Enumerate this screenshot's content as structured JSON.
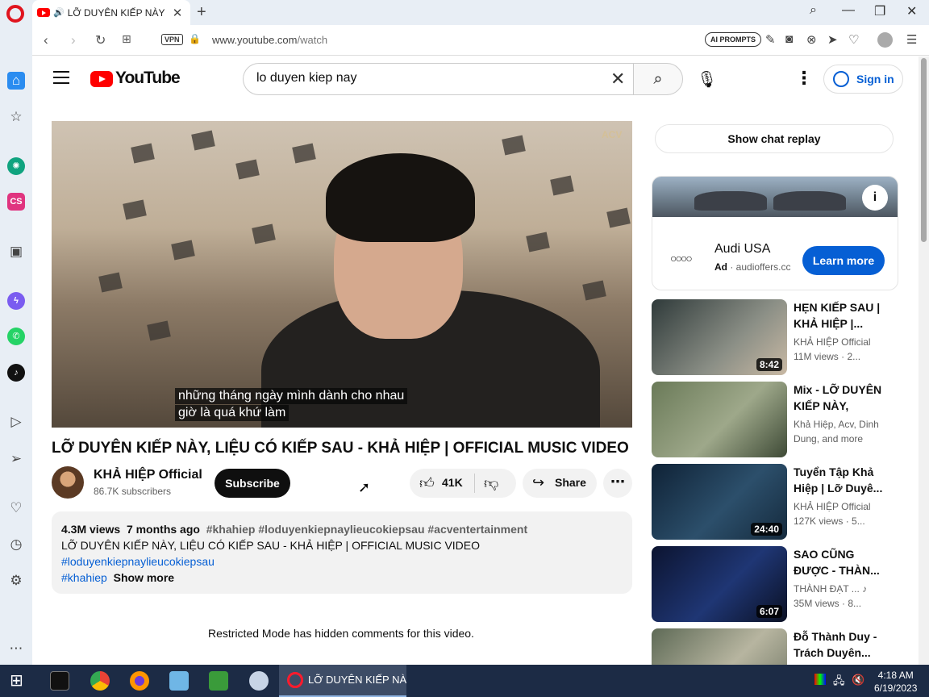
{
  "browser": {
    "tab_title": "LỠ DUYÊN KIẾP NÀY, LI",
    "url_host": "www.youtube.com",
    "url_path": "/watch",
    "vpn_label": "VPN",
    "ai_prompts_label": "AI PROMPTS",
    "new_tab_glyph": "+",
    "tab_close_glyph": "✕"
  },
  "youtube": {
    "logo_text": "YouTube",
    "search_value": "lo duyen kiep nay",
    "sign_in_label": "Sign in"
  },
  "video": {
    "subtitle_line1": "những tháng ngày mình dành cho nhau",
    "subtitle_line2": "giờ là quá khứ làm",
    "watermark": "ACV",
    "title": "LỠ DUYÊN KIẾP NÀY, LIỆU CÓ KIẾP SAU - KHẢ HIỆP | OFFICIAL MUSIC VIDEO",
    "channel_name": "KHẢ HIỆP Official",
    "subscribers": "86.7K subscribers",
    "subscribe_label": "Subscribe",
    "like_count": "41K",
    "share_label": "Share"
  },
  "description": {
    "views": "4.3M views",
    "age": "7 months ago",
    "tags": "#khahiep #loduyenkiepnaylieucokiepsau #acventertainment",
    "line1": "LỠ DUYÊN KIẾP NÀY, LIỆU CÓ KIẾP SAU - KHẢ HIỆP | OFFICIAL MUSIC VIDEO",
    "link1": "#loduyenkiepnaylieucokiepsau",
    "link2": "#khahiep",
    "show_more": "Show more"
  },
  "comments": {
    "restricted_note": "Restricted Mode has hidden comments for this video."
  },
  "sidebar_right": {
    "chat_replay_label": "Show chat replay",
    "ad": {
      "brand": "Audi USA",
      "ad_tag": "Ad",
      "domain": "· audioffers.cc",
      "cta": "Learn more",
      "info_glyph": "i"
    },
    "recommendations": [
      {
        "title": "HẸN KIẾP SAU | KHẢ HIỆP |...",
        "channel": "KHẢ HIỆP Official",
        "views": "11M views · 2...",
        "duration": "8:42"
      },
      {
        "title": "Mix - LỠ DUYÊN KIẾP NÀY, LIỆU...",
        "channel": "Khả Hiệp, Acv, Dinh",
        "views": "Dung, and more",
        "duration": ""
      },
      {
        "title": "Tuyển Tập Khả Hiệp | Lỡ Duyê...",
        "channel": "KHẢ HIỆP Official",
        "views": "127K views · 5...",
        "duration": "24:40"
      },
      {
        "title": "SAO CŨNG ĐƯỢC - THÀN...",
        "channel": "THÀNH ĐẠT ... ♪",
        "views": "35M views · 8...",
        "duration": "6:07"
      },
      {
        "title": "Đỗ Thành Duy - Trách Duyên...",
        "channel": "",
        "views": "",
        "duration": ""
      }
    ]
  },
  "taskbar": {
    "opera_label": "LỠ DUYÊN KIẾP NÀ...",
    "time": "4:18 AM",
    "date": "6/19/2023"
  }
}
